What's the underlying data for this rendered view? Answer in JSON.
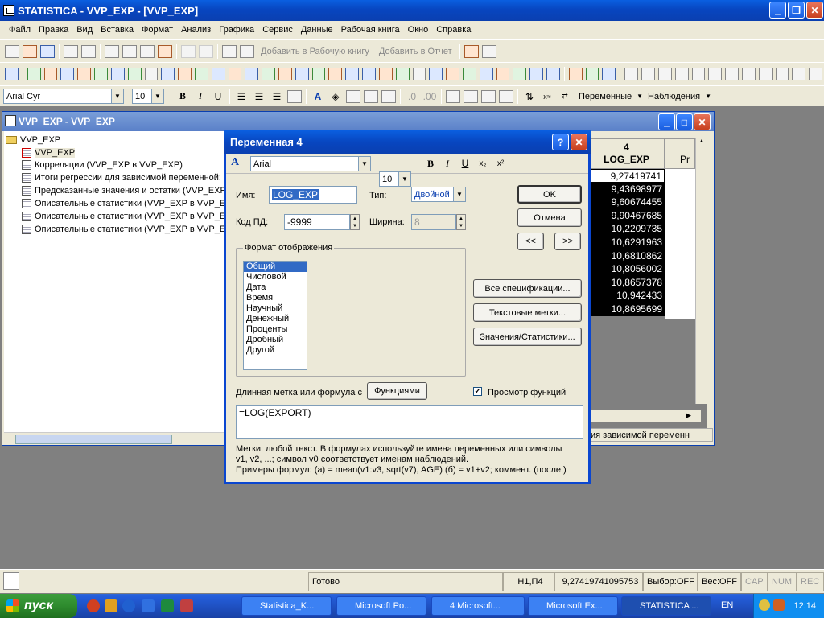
{
  "app": {
    "title": "STATISTICA - VVP_EXP - [VVP_EXP]"
  },
  "menu": [
    "Файл",
    "Правка",
    "Вид",
    "Вставка",
    "Формат",
    "Анализ",
    "Графика",
    "Сервис",
    "Данные",
    "Рабочая книга",
    "Окно",
    "Справка"
  ],
  "toolbar": {
    "add_workbook": "Добавить в Рабочую книгу",
    "add_report": "Добавить в Отчет"
  },
  "format_toolbar": {
    "font": "Arial Cyr",
    "size": "10",
    "vars": "Переменные",
    "cases": "Наблюдения"
  },
  "workbook": {
    "title": "VVP_EXP - VVP_EXP",
    "tree": [
      "VVP_EXP",
      "VVP_EXP",
      "Корреляции (VVP_EXP в VVP_EXP)",
      "Итоги регрессии для зависимой переменной:",
      "Предсказанные значения и остатки (VVP_EXP",
      "Описательные статистики (VVP_EXP в VVP_EX",
      "Описательные статистики (VVP_EXP в VVP_EX",
      "Описательные статистики (VVP_EXP в VVP_EX"
    ],
    "tab_label": "ия зависимой переменн"
  },
  "grid": {
    "col_num": "4",
    "col_name": "LOG_EXP",
    "next_col": "Pr",
    "values": [
      "9,27419741",
      "9,43698977",
      "9,60674455",
      "9,90467685",
      "10,2209735",
      "10,6291963",
      "10,6810862",
      "10,8056002",
      "10,8657378",
      "10,942433",
      "10,8695699"
    ]
  },
  "dialog": {
    "title": "Переменная 4",
    "font": "Arial",
    "size": "10",
    "name_label": "Имя:",
    "name_value": "LOG_EXP",
    "type_label": "Тип:",
    "type_value": "Двойной",
    "md_label": "Код ПД:",
    "md_value": "-9999",
    "width_label": "Ширина:",
    "width_value": "8",
    "ok": "OK",
    "cancel": "Отмена",
    "prev": "<<",
    "next": ">>",
    "format_group": "Формат отображения",
    "formats": [
      "Общий",
      "Числовой",
      "Дата",
      "Время",
      "Научный",
      "Денежный",
      "Проценты",
      "Дробный",
      "Другой"
    ],
    "all_specs": "Все спецификации...",
    "text_labels": "Текстовые метки...",
    "values_stats": "Значения/Статистики...",
    "long_label": "Длинная метка или формула с",
    "functions": "Функциями",
    "preview": "Просмотр функций",
    "formula": "=LOG(EXPORT)",
    "help1": "Метки: любой текст.    В формулах используйте имена переменных или символы",
    "help2": "v1, v2, ...; символ v0 соответствует именам наблюдений.",
    "help3": "Примеры формул:  (a) = mean(v1:v3, sqrt(v7), AGE)   (б) = v1+v2; коммент. (после;)"
  },
  "status": {
    "ready": "Готово",
    "cell": "H1,П4",
    "value": "9,27419741095753",
    "sel": "Выбор:OFF",
    "wt": "Вес:OFF",
    "cap": "CAP",
    "num": "NUM",
    "rec": "REC"
  },
  "taskbar": {
    "start": "пуск",
    "tasks": [
      "Statistica_K...",
      "Microsoft Po...",
      "4 Microsoft...",
      "Microsoft Ex...",
      "STATISTICA ..."
    ],
    "lang": "EN",
    "time": "12:14"
  }
}
